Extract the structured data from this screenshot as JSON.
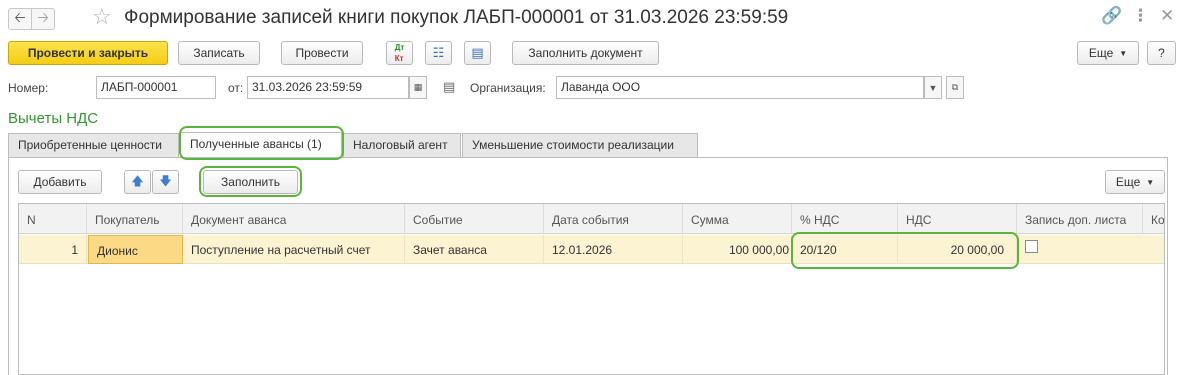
{
  "window": {
    "back_icon": "arrow-left-icon",
    "forward_icon": "arrow-right-icon",
    "favorite_icon": "star-icon",
    "title": "Формирование записей книги покупок ЛАБП-000001 от 31.03.2026 23:59:59",
    "link_icon": "link-icon",
    "more_icon": "more-vertical-icon",
    "close_icon": "close-icon"
  },
  "toolbar": {
    "post_close": "Провести и закрыть",
    "save": "Записать",
    "post": "Провести",
    "dtkt_icon": "dt-kt-icon",
    "fill_document": "Заполнить документ",
    "more": "Еще",
    "help": "?"
  },
  "header": {
    "number_label": "Номер:",
    "number_value": "ЛАБП-000001",
    "date_label": "от:",
    "date_value": "31.03.2026 23:59:59",
    "org_label": "Организация:",
    "org_value": "Лаванда ООО"
  },
  "section_title": "Вычеты НДС",
  "tabs": [
    {
      "label": "Приобретенные ценности"
    },
    {
      "label": "Полученные авансы (1)"
    },
    {
      "label": "Налоговый агент"
    },
    {
      "label": "Уменьшение стоимости реализации"
    }
  ],
  "table_toolbar": {
    "add": "Добавить",
    "fill": "Заполнить",
    "more": "Еще"
  },
  "table": {
    "columns": [
      "N",
      "Покупатель",
      "Документ аванса",
      "Событие",
      "Дата события",
      "Сумма",
      "% НДС",
      "НДС",
      "Запись доп. листа",
      "Ко"
    ],
    "rows": [
      {
        "n": "1",
        "buyer": "Дионис",
        "doc": "Поступление на расчетный счет",
        "event": "Зачет аванса",
        "date": "12.01.2026",
        "sum": "100 000,00",
        "vat_rate": "20/120",
        "vat": "20 000,00",
        "extra_sheet": false
      }
    ]
  },
  "colors": {
    "highlight": "#5ab53b",
    "primary_button": "#f4cd14",
    "section_title": "#2f9a2f",
    "selected_row": "#fbf3d2"
  }
}
